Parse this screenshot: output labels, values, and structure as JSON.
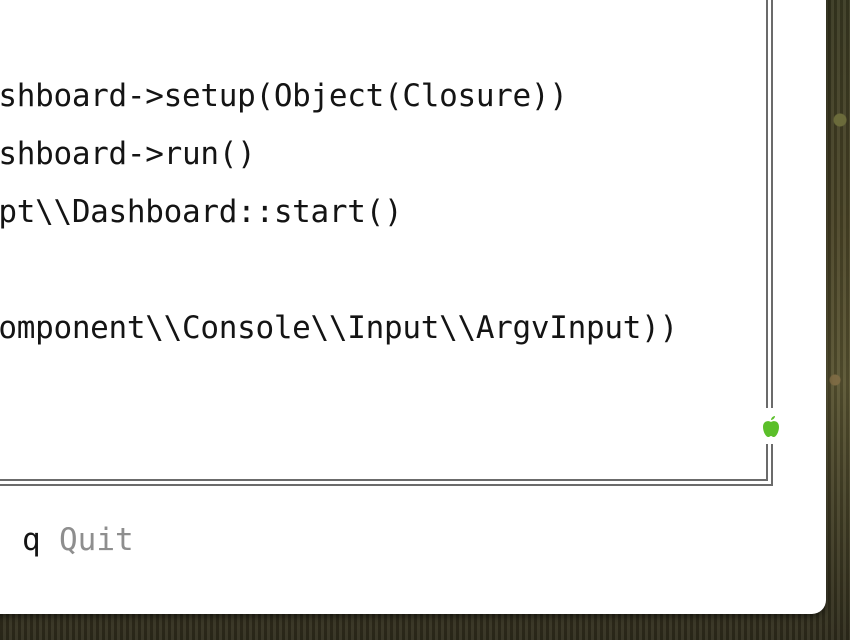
{
  "terminal": {
    "lines": [
      "ashboard->setup(Object(Closure))",
      "ashboard->run()",
      "npt\\\\Dashboard::start()",
      "Component\\\\Console\\\\Input\\\\ArgvInput))"
    ]
  },
  "footer": {
    "key": "q",
    "label": "Quit"
  },
  "colors": {
    "text": "#141414",
    "muted": "#8e8e8e",
    "frame": "#6b6b6b",
    "accent": "#5bbf2a"
  },
  "icons": {
    "status": "apple-icon"
  }
}
